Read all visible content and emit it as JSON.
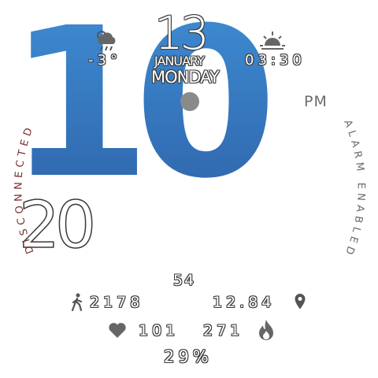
{
  "weather": {
    "temperature": "-3°",
    "icon": "cloud-rain-icon"
  },
  "date": {
    "day": "13",
    "month": "JANUARY",
    "weekday": "MONDAY"
  },
  "sun": {
    "time": "03:30",
    "icon": "sunrise-icon"
  },
  "time": {
    "hour": "10",
    "minutes": "20",
    "seconds": "54",
    "ampm": "PM"
  },
  "status": {
    "bluetooth": "DISCONNECTED",
    "alarm": "ALARM ENABLED"
  },
  "health": {
    "steps": "2178",
    "distance": "12.84",
    "heart_rate": "101",
    "calories": "271",
    "battery": "29%"
  },
  "colors": {
    "hour_fill_top": "#3f8fd6",
    "hour_fill_bottom": "#2e62a8",
    "disconnected": "#7a2d2a",
    "text_outline": "#3a3a3a",
    "dot": "#8a8a8a"
  }
}
